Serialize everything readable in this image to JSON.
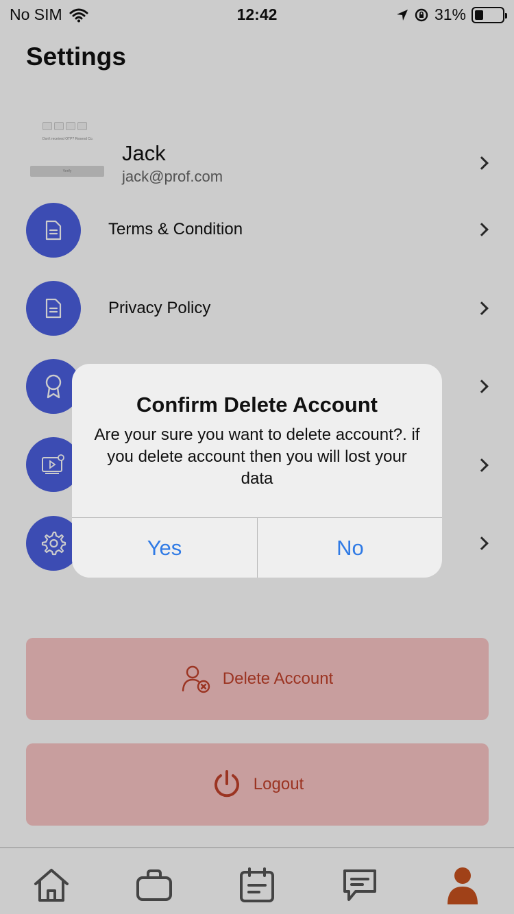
{
  "status_bar": {
    "carrier": "No SIM",
    "time": "12:42",
    "battery": "31%"
  },
  "header": {
    "title": "Settings"
  },
  "profile": {
    "name": "Jack",
    "email": "jack@prof.com",
    "thumbnail_caption": "Don't received OTP? Resend Co.",
    "thumbnail_button": "Verify"
  },
  "menu": {
    "items": [
      {
        "label": "Terms & Condition",
        "icon": "document-icon"
      },
      {
        "label": "Privacy Policy",
        "icon": "document-icon"
      },
      {
        "label": "",
        "icon": "award-icon"
      },
      {
        "label": "",
        "icon": "video-settings-icon"
      },
      {
        "label": "",
        "icon": "gear-icon"
      }
    ]
  },
  "actions": {
    "delete_label": "Delete Account",
    "logout_label": "Logout"
  },
  "tab_bar": {
    "items": [
      {
        "icon": "home-icon"
      },
      {
        "icon": "briefcase-icon"
      },
      {
        "icon": "calendar-icon"
      },
      {
        "icon": "chat-icon"
      },
      {
        "icon": "profile-icon",
        "active": true
      }
    ]
  },
  "dialog": {
    "title": "Confirm Delete Account",
    "message": "Are your sure you want to delete account?. if you delete account then you will lost your data",
    "yes_label": "Yes",
    "no_label": "No"
  },
  "colors": {
    "accent": "#4b5fe0",
    "danger_bg": "#fbc6c6",
    "danger_text": "#c2412b",
    "active_tab": "#c9521f",
    "dialog_button": "#2f7ae5"
  }
}
